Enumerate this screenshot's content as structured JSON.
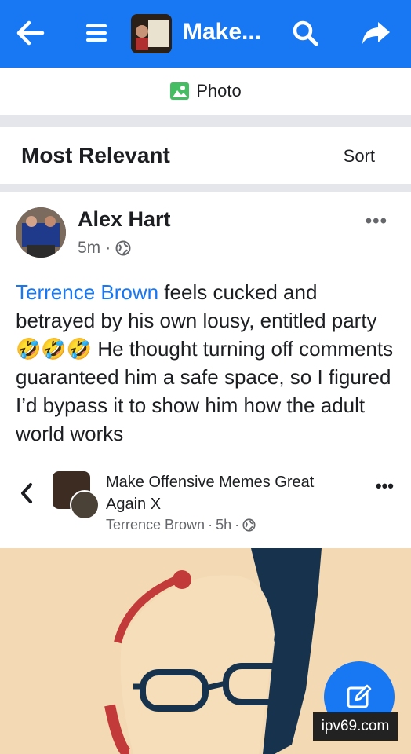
{
  "header": {
    "back_icon": "arrow-left-icon",
    "menu_icon": "menu-icon",
    "group_title": "Make...",
    "search_icon": "search-icon",
    "share_icon": "share-icon"
  },
  "composer": {
    "photo_label": "Photo",
    "photo_icon": "photo-icon"
  },
  "comments_header": {
    "title": "Most Relevant",
    "sort_label": "Sort"
  },
  "post": {
    "author": "Alex Hart",
    "time": "5m",
    "more": "•••",
    "mention": "Terrence Brown",
    "text_before_emoji": " feels cucked and betrayed by his own lousy, entitled party ",
    "emoji": "🤣🤣🤣",
    "text_after_emoji": " He thought turning off comments guaranteed him a safe space, so I figured I’d bypass it to show him how the adult world works"
  },
  "shared": {
    "group_name": "Make Offensive Memes Great Again X",
    "shared_by": "Terrence Brown",
    "shared_time": "5h",
    "more": "•••"
  },
  "watermark": "ipv69.com",
  "colors": {
    "brand": "#1877f2",
    "separator": "#e4e6eb",
    "secondary_text": "#65676b"
  }
}
